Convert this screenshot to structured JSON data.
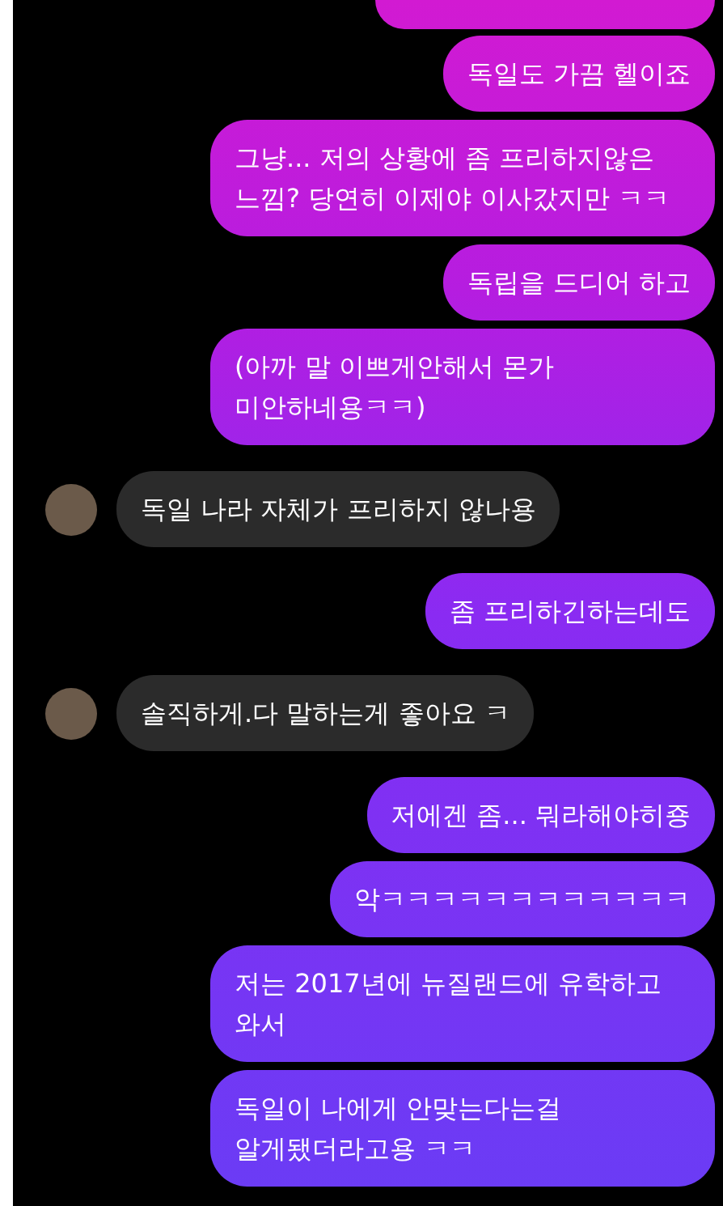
{
  "messages": [
    {
      "kind": "outgoing",
      "text": "독일도 가끔 헬이죠"
    },
    {
      "kind": "outgoing",
      "text": "그냥... 저의 상황에 좀 프리하지않은 느낌? 당연히 이제야 이사갔지만 ㅋㅋ"
    },
    {
      "kind": "outgoing",
      "text": "독립을 드디어 하고"
    },
    {
      "kind": "outgoing",
      "text": "(아까 말 이쁘게안해서 몬가 미안하네용ㅋㅋ)"
    },
    {
      "kind": "incoming",
      "text": "독일 나라 자체가 프리하지 않나용"
    },
    {
      "kind": "outgoing",
      "text": "좀 프리하긴하는데도"
    },
    {
      "kind": "incoming",
      "text": "솔직하게.다 말하는게 좋아요 ㅋ"
    },
    {
      "kind": "outgoing",
      "text": "저에겐 좀... 뭐라해야히죵"
    },
    {
      "kind": "outgoing",
      "text": "악ㅋㅋㅋㅋㅋㅋㅋㅋㅋㅋㅋㅋ"
    },
    {
      "kind": "outgoing",
      "text": "저는 2017년에 뉴질랜드에 유학하고 와서"
    },
    {
      "kind": "outgoing",
      "text": "독일이 나에게 안맞는다는걸 알게됐더라고용 ㅋㅋ"
    }
  ]
}
